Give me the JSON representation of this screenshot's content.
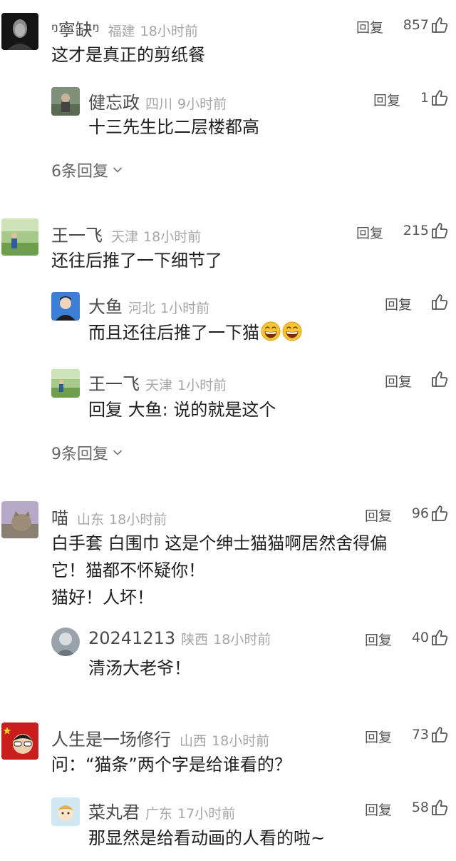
{
  "colors": {
    "name": "#4a4a4a",
    "meta": "#a6a6a6",
    "body": "#1f1f1f",
    "action": "#555555"
  },
  "threads": [
    {
      "user": "ᵑ寧缺ᵑ",
      "location": "福建",
      "time": "18小时前",
      "reply": "回复",
      "likes": "857",
      "text": "这才是真正的剪纸餐",
      "subs": [
        {
          "user": "健忘政",
          "location": "四川",
          "time": "9小时前",
          "reply": "回复",
          "likes": "1",
          "text": "十三先生比二层楼都高"
        }
      ],
      "more": "6条回复"
    },
    {
      "user": "王一飞",
      "location": "天津",
      "time": "18小时前",
      "reply": "回复",
      "likes": "215",
      "text": "还往后推了一下细节了",
      "subs": [
        {
          "user": "大鱼",
          "location": "河北",
          "time": "1小时前",
          "reply": "回复",
          "likes": "",
          "text": "而且还往后推了一下猫",
          "emoji": "grinning-face-icon"
        },
        {
          "user": "王一飞",
          "location": "天津",
          "time": "1小时前",
          "reply": "回复",
          "likes": "",
          "text": "回复 大鱼: 说的就是这个"
        }
      ],
      "more": "9条回复"
    },
    {
      "user": "喵",
      "location": "山东",
      "time": "18小时前",
      "reply": "回复",
      "likes": "96",
      "text": "白手套 白围巾 这是个绅士猫猫啊居然舍得偏\n它！猫都不怀疑你！\n猫好！人坏！",
      "subs": [
        {
          "user": "20241213",
          "location": "陕西",
          "time": "18小时前",
          "reply": "回复",
          "likes": "40",
          "text": "清汤大老爷！"
        }
      ]
    },
    {
      "user": "人生是一场修行",
      "location": "山西",
      "time": "18小时前",
      "reply": "回复",
      "likes": "73",
      "text": "问：“猫条”两个字是给谁看的？",
      "subs": [
        {
          "user": "菜丸君",
          "location": "广东",
          "time": "17小时前",
          "reply": "回复",
          "likes": "58",
          "text": "那显然是给看动画的人看的啦~"
        }
      ]
    }
  ]
}
